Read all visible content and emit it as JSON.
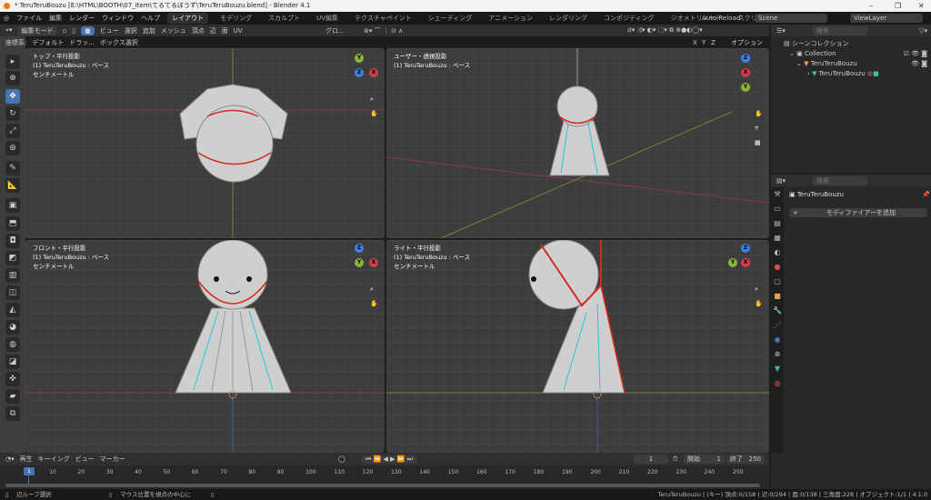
{
  "titlebar": {
    "title": "* TeruTeruBouzu [E:\\HTML\\BOOTH\\07_Item\\てるてるぼうず\\TeruTeruBouzu.blend] - Blender 4.1",
    "minimize": "–",
    "maximize": "❐",
    "close": "✕"
  },
  "menu": [
    "ファイル",
    "編集",
    "レンダー",
    "ウィンドウ",
    "ヘルプ"
  ],
  "workspaces": [
    "レイアウト",
    "モデリング",
    "スカルプト",
    "UV編集",
    "テクスチャペイント",
    "シェーディング",
    "アニメーション",
    "レンダリング",
    "コンポジティング",
    "ジオメトリノード",
    "スクリプト作成",
    "+"
  ],
  "topright": {
    "auto_reload": "Auto Reload",
    "scene": "Scene",
    "view_layer": "ViewLayer"
  },
  "viewport_header": {
    "mode": "編集モード",
    "menus": [
      "ビュー",
      "選択",
      "追加",
      "メッシュ",
      "頂点",
      "辺",
      "面",
      "UV"
    ],
    "transform": "グロ...",
    "options": "オプション",
    "axes": [
      "X",
      "Y",
      "Z"
    ]
  },
  "tool_settings": {
    "orientation_label": "座標系:",
    "orientation": "デフォルト",
    "drag": "ドラッ...",
    "select": "ボックス選択"
  },
  "viewports": [
    {
      "name": "トップ・平行投影",
      "object": "(1) TeruTeruBouzu : ベース",
      "unit": "センチメートル"
    },
    {
      "name": "ユーザー・透視投影",
      "object": "(1) TeruTeruBouzu : ベース",
      "unit": ""
    },
    {
      "name": "フロント・平行投影",
      "object": "(1) TeruTeruBouzu : ベース",
      "unit": "センチメートル"
    },
    {
      "name": "ライト・平行投影",
      "object": "(1) TeruTeruBouzu : ベース",
      "unit": "センチメートル"
    }
  ],
  "outliner": {
    "search_placeholder": "検索",
    "items": [
      {
        "label": "シーンコレクション"
      },
      {
        "label": "Collection"
      },
      {
        "label": "TeruTeruBouzu"
      },
      {
        "label": "TeruTeruBouzu"
      }
    ]
  },
  "properties": {
    "search_placeholder": "検索",
    "object": "TeruTeruBouzu",
    "add_modifier": "モディファイアーを追加"
  },
  "timeline": {
    "menus": [
      "再生",
      "キーイング",
      "ビュー",
      "マーカー"
    ],
    "current_frame": "1",
    "start_label": "開始",
    "start": "1",
    "end_label": "終了",
    "end": "250",
    "ticks": [
      "10",
      "20",
      "30",
      "40",
      "50",
      "60",
      "70",
      "80",
      "90",
      "100",
      "110",
      "120",
      "130",
      "140",
      "150",
      "160",
      "170",
      "180",
      "190",
      "200",
      "210",
      "220",
      "230",
      "240",
      "250"
    ]
  },
  "status": {
    "left": "辺ループ選択",
    "middle": "マウス位置を視点の中心に",
    "right": "TeruTeruBouzu | (キー) 頂点:0/158 | 辺:0/294 | 面:0/138 | 三角面:228 | オブジェクト:1/1 | 4.1.0"
  },
  "colors": {
    "accent": "#4772b3",
    "x_axis": "#d63b4e",
    "y_axis": "#89b43c",
    "z_axis": "#3f82dc",
    "seam": "#d32b1e",
    "edge_cyan": "#1ec8d8"
  }
}
